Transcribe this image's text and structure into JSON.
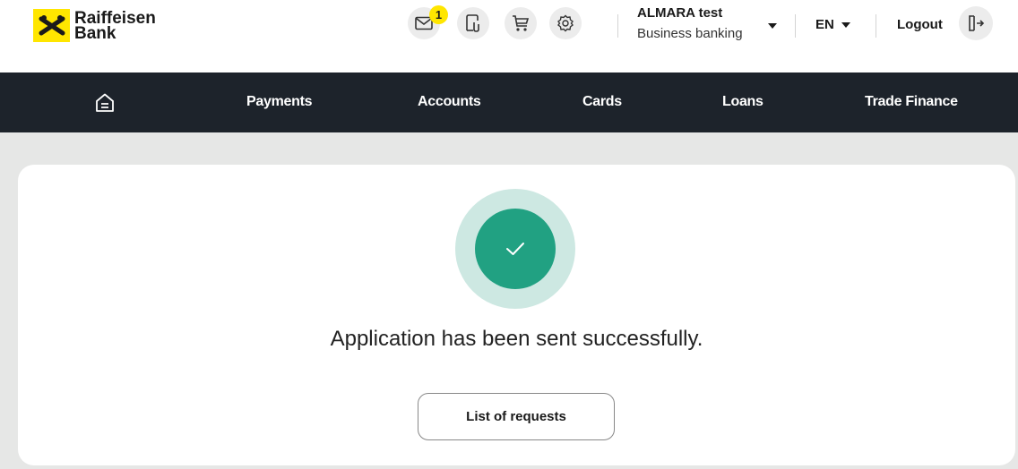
{
  "brand": {
    "line1": "Raiffeisen",
    "line2": "Bank",
    "accent": "#ffe600"
  },
  "header": {
    "icons": [
      "envelope-icon",
      "mobile-signature-icon",
      "cart-icon",
      "settings-gear-icon"
    ],
    "messages_badge": "1",
    "user_name": "ALMARA test",
    "user_role": "Business banking",
    "language": "EN",
    "logout": "Logout"
  },
  "nav": {
    "background": "#1d232b",
    "items": [
      "Payments",
      "Accounts",
      "Cards",
      "Loans",
      "Trade Finance"
    ]
  },
  "main": {
    "success_color": "#21a182",
    "message": "Application has been sent successfully.",
    "button_label": "List of requests"
  }
}
